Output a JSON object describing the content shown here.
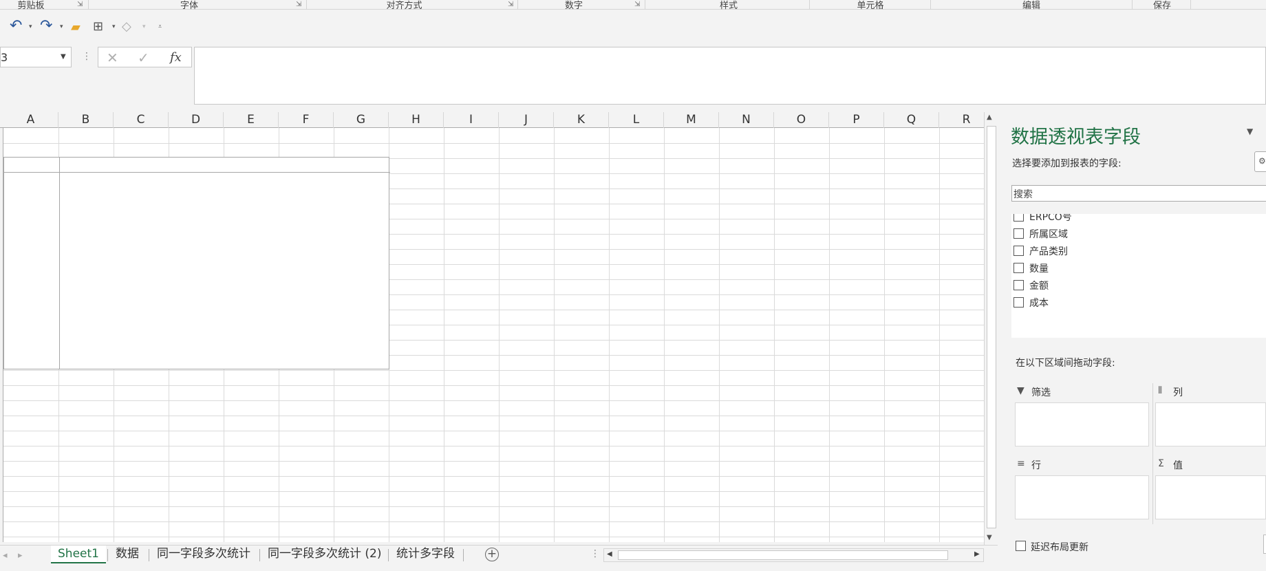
{
  "ribbon": {
    "groups": [
      "剪贴板",
      "字体",
      "对齐方式",
      "数字",
      "样式",
      "单元格",
      "编辑",
      "保存"
    ]
  },
  "quick_access": {
    "items": [
      "undo-icon",
      "redo-icon",
      "open-folder-icon",
      "layout-icon",
      "shapes-icon",
      "customize-icon"
    ]
  },
  "formula_bar": {
    "name_box": "3",
    "fx_label": "fx",
    "cancel_symbol": "✕",
    "enter_symbol": "✓",
    "value": ""
  },
  "grid": {
    "columns": [
      "A",
      "B",
      "C",
      "D",
      "E",
      "F",
      "G",
      "H",
      "I",
      "J",
      "K",
      "L",
      "M",
      "N",
      "O",
      "P",
      "Q",
      "R"
    ]
  },
  "sheet_tabs": {
    "tabs": [
      "Sheet1",
      "数据",
      "同一字段多次统计",
      "同一字段多次统计 (2)",
      "统计多字段"
    ],
    "active": "Sheet1"
  },
  "pivot_pane": {
    "title": "数据透视表字段",
    "subtitle": "选择要添加到报表的字段:",
    "search_placeholder": "搜索",
    "fields": [
      "ERPCO号",
      "所属区域",
      "产品类别",
      "数量",
      "金额",
      "成本"
    ],
    "drag_hint": "在以下区域间拖动字段:",
    "areas": {
      "filter": "筛选",
      "columns": "列",
      "rows": "行",
      "values": "值"
    },
    "defer_label": "延迟布局更新"
  },
  "colors": {
    "accent": "#217346",
    "grid_line": "#dadada",
    "header_bg": "#f3f3f3"
  }
}
